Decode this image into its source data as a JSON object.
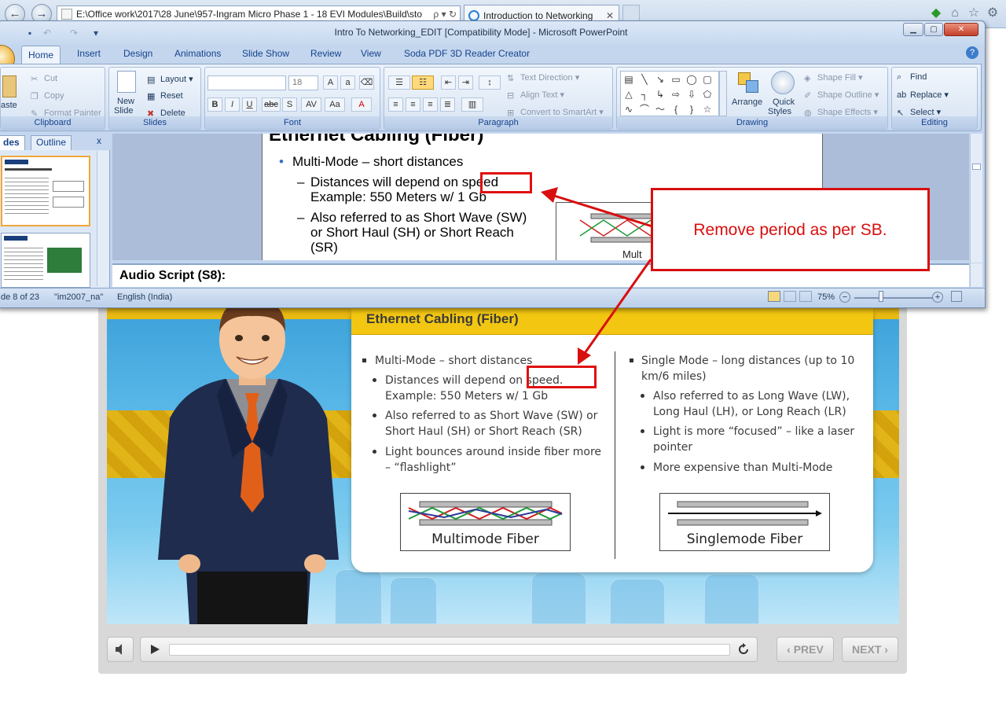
{
  "browser": {
    "address": "E:\\Office work\\2017\\28 June\\957-Ingram Micro Phase 1 - 18 EVI Modules\\Build\\sto",
    "address_tools": "ρ ▾ ↻",
    "active_tab_title": "Introduction to Networking",
    "close_glyph": "✕"
  },
  "ppt": {
    "window_title": "Intro To Networking_EDIT [Compatibility Mode] - Microsoft PowerPoint",
    "tabs": [
      "Home",
      "Insert",
      "Design",
      "Animations",
      "Slide Show",
      "Review",
      "View",
      "Soda PDF 3D Reader Creator"
    ],
    "clipboard": {
      "paste": "aste",
      "cut": "Cut",
      "copy": "Copy",
      "format_painter": "Format Painter",
      "label": "Clipboard"
    },
    "slides_group": {
      "new_slide": "New",
      "new_slide2": "Slide",
      "layout": "Layout",
      "reset": "Reset",
      "delete": "Delete",
      "label": "Slides"
    },
    "font_group": {
      "font_size": "18",
      "label": "Font"
    },
    "paragraph_group": {
      "text_direction": "Text Direction",
      "align_text": "Align Text",
      "convert_smartart": "Convert to SmartArt",
      "label": "Paragraph"
    },
    "drawing_group": {
      "arrange": "Arrange",
      "quick_styles": "Quick",
      "quick_styles2": "Styles",
      "shape_fill": "Shape Fill",
      "shape_outline": "Shape Outline",
      "shape_effects": "Shape Effects",
      "label": "Drawing"
    },
    "editing_group": {
      "find": "Find",
      "replace": "Replace",
      "select": "Select",
      "label": "Editing"
    },
    "panel_tabs": {
      "slides": "des",
      "outline": "Outline",
      "close": "x"
    },
    "slide": {
      "title": "Ethernet Cabling (Fiber)",
      "bullet1": "Multi-Mode – short distances",
      "sub1_line1": "Distances will depend on speed",
      "sub1_line2": "Example: 550 Meters w/ 1 Gb",
      "sub2_line1": "Also referred to as Short Wave (SW)",
      "sub2_line2": "or Short Haul (SH) or Short Reach",
      "sub2_line3": "(SR)",
      "partial_label": "Mult"
    },
    "notes": "Audio Script (S8):",
    "status": {
      "slide_count": "de 8 of 23",
      "theme": "\"im2007_na\"",
      "language": "English (India)",
      "zoom": "75%"
    }
  },
  "course": {
    "title": "Ethernet Cabling (Fiber)",
    "left": {
      "b1": "Multi-Mode – short distances",
      "s1a": "Distances will depend on speed.",
      "s1b": "Example: 550 Meters w/ 1 Gb",
      "s2a": "Also referred to as Short Wave (SW) or",
      "s2b": "Short Haul (SH) or Short Reach (SR)",
      "s3a": "Light bounces around inside fiber more",
      "s3b": "– “flashlight”",
      "figure": "Multimode Fiber"
    },
    "right": {
      "b1a": "Single Mode – long distances (up to 10",
      "b1b": "km/6 miles)",
      "s1a": "Also referred to as Long Wave (LW),",
      "s1b": "Long Haul (LH), or Long Reach (LR)",
      "s2a": "Light is more “focused” – like a laser",
      "s2b": "pointer",
      "s3": "More expensive than Multi-Mode",
      "figure": "Singlemode Fiber"
    },
    "controls": {
      "prev": "PREV",
      "next": "NEXT"
    }
  },
  "annotation": {
    "callout": "Remove period as per SB.",
    "color": "#d80f0f"
  }
}
